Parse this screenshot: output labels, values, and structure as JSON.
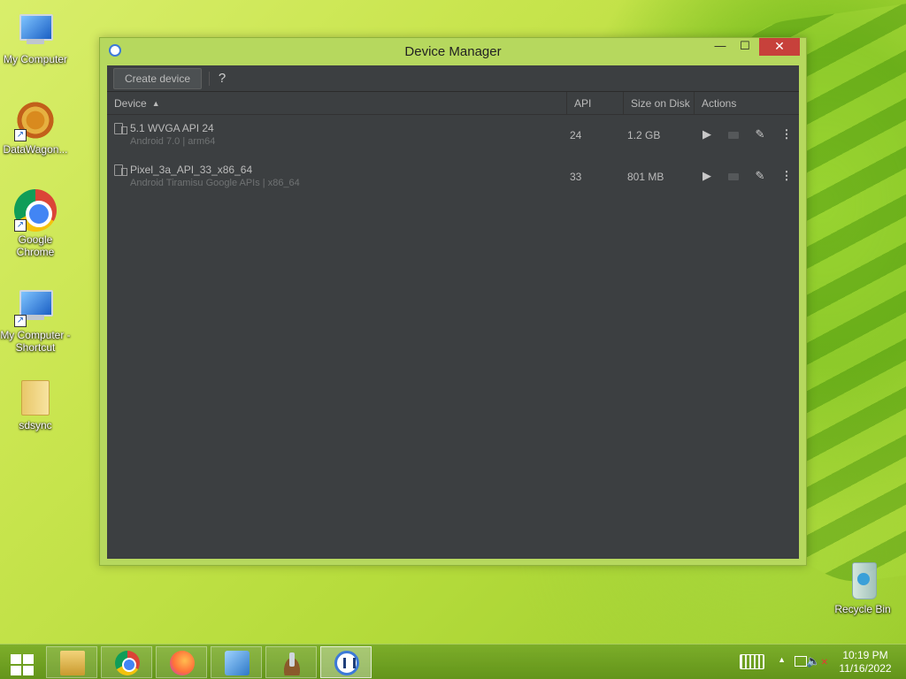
{
  "desktop": {
    "icons": [
      {
        "label": "My Computer"
      },
      {
        "label": "DataWagon..."
      },
      {
        "label": "Google Chrome"
      },
      {
        "label": "My Computer - Shortcut"
      },
      {
        "label": "sdsync"
      },
      {
        "label": "Recycle Bin"
      }
    ]
  },
  "window": {
    "title": "Device Manager",
    "controls": {
      "minimize": "—",
      "maximize": "☐",
      "close": "✕"
    }
  },
  "toolbar": {
    "create_label": "Create device",
    "help_label": "?"
  },
  "table": {
    "columns": {
      "device": "Device",
      "api": "API",
      "size": "Size on Disk",
      "actions": "Actions"
    },
    "sort_indicator": "▲",
    "rows": [
      {
        "name": "5.1  WVGA API 24",
        "sub": "Android 7.0 | arm64",
        "api": "24",
        "size": "1.2 GB"
      },
      {
        "name": "Pixel_3a_API_33_x86_64",
        "sub": "Android Tiramisu Google APIs | x86_64",
        "api": "33",
        "size": "801 MB"
      }
    ],
    "action_glyphs": {
      "run": "▶",
      "edit": "✎",
      "more": "⋮"
    }
  },
  "taskbar": {
    "clock_time": "10:19 PM",
    "clock_date": "11/16/2022",
    "tray_arrow": "▲",
    "volume_glyph": "🔈",
    "mute_glyph": "✕"
  },
  "colors": {
    "client_bg": "#3c3f41",
    "window_frame": "#b6d85e",
    "close_button": "#c7413b",
    "taskbar": "#6a9b22"
  },
  "icon_names": [
    "computer-icon",
    "datawagon-icon",
    "chrome-icon",
    "folder-icon",
    "recycle-bin-icon",
    "android-studio-icon",
    "firefox-icon",
    "control-panel-icon",
    "device-icon",
    "run-icon",
    "folder-icon",
    "edit-icon",
    "more-icon",
    "keyboard-icon",
    "network-icon",
    "volume-muted-icon"
  ]
}
